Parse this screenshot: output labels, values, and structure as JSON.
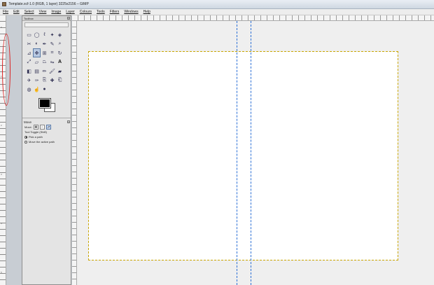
{
  "window": {
    "title": "Template.xcf-1.0 (RGB, 1 layer) 3225x2156 – GIMP"
  },
  "menu": [
    "File",
    "Edit",
    "Select",
    "View",
    "Image",
    "Layer",
    "Colours",
    "Tools",
    "Filters",
    "Windows",
    "Help"
  ],
  "toolbox": {
    "title": "Toolbox",
    "close_glyph": "x",
    "tools": [
      "rect-select-icon",
      "ellipse-select-icon",
      "lasso-icon",
      "fuzzy-select-icon",
      "color-select-icon",
      "scissors-icon",
      "foreground-select-icon",
      "paths-icon",
      "color-picker-icon",
      "zoom-icon",
      "measure-icon",
      "move-icon",
      "align-icon",
      "crop-icon",
      "rotate-icon",
      "scale-icon",
      "shear-icon",
      "perspective-icon",
      "flip-icon",
      "text-icon",
      "bucket-fill-icon",
      "blend-icon",
      "pencil-icon",
      "paintbrush-icon",
      "eraser-icon",
      "airbrush-icon",
      "ink-icon",
      "clone-icon",
      "heal-icon",
      "perspective-clone-icon",
      "blur-icon",
      "smudge-icon",
      "dodge-burn-icon"
    ],
    "active_tool_index": 11,
    "foreground_color": "#000000",
    "background_color": "#ffffff"
  },
  "tool_options": {
    "title": "Move",
    "move_label": "Move:",
    "toggle_label": "Tool Toggle  (Shift)",
    "options": [
      "Pick a path",
      "Move the active path"
    ],
    "selected_option": 0
  },
  "ruler": {
    "left_ticks": [
      "0",
      "1",
      "2",
      "3",
      "4",
      "5"
    ]
  },
  "colors": {
    "guide": "#2a6fd6",
    "page_border": "#c9a600",
    "annotation": "#dd2222"
  }
}
